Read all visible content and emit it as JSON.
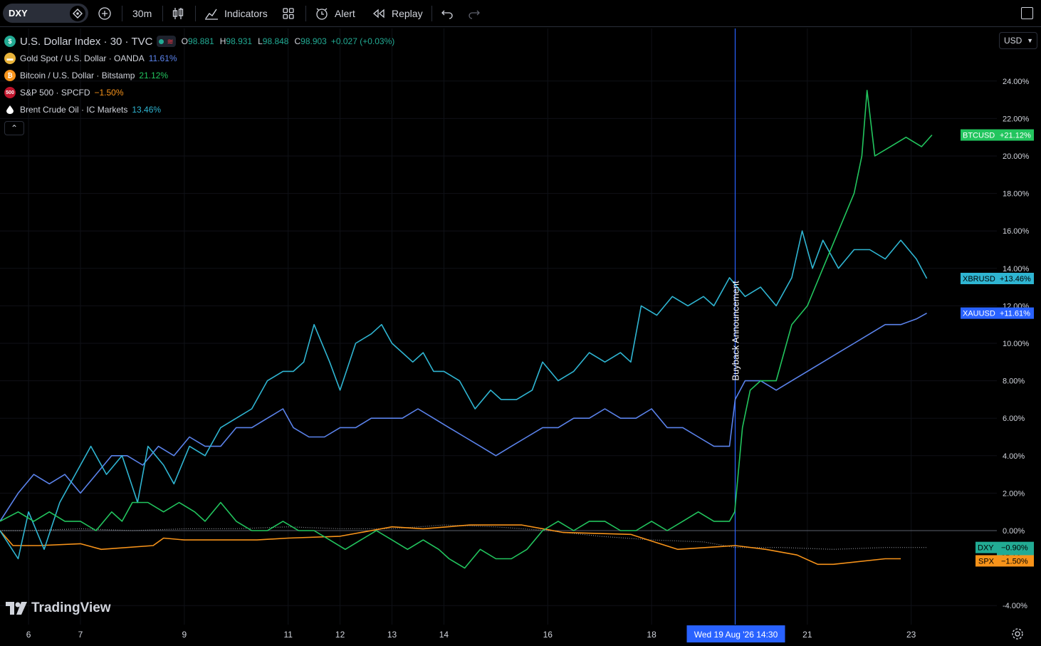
{
  "toolbar": {
    "symbol": "DXY",
    "interval": "30m",
    "indicators_label": "Indicators",
    "alert_label": "Alert",
    "replay_label": "Replay"
  },
  "legend": {
    "main": {
      "title": "U.S. Dollar Index · 30 · TVC",
      "o_label": "O",
      "o": "98.881",
      "h_label": "H",
      "h": "98.931",
      "l_label": "L",
      "l": "98.848",
      "c_label": "C",
      "c": "98.903",
      "change": "+0.027 (+0.03%)"
    },
    "series": [
      {
        "title": "Gold Spot / U.S. Dollar · OANDA",
        "value": "11.61%",
        "color": "#5b83ec",
        "icon": "gold-icon"
      },
      {
        "title": "Bitcoin / U.S. Dollar · Bitstamp",
        "value": "21.12%",
        "color": "#22c55e",
        "icon": "bitcoin-icon"
      },
      {
        "title": "S&P 500 · SPCFD",
        "value": "−1.50%",
        "color": "#f7931a",
        "icon": "sp500-icon",
        "icon_text": "500"
      },
      {
        "title": "Brent Crude Oil · IC Markets",
        "value": "13.46%",
        "color": "#2fb5d2",
        "icon": "oil-drop-icon"
      }
    ]
  },
  "currency": "USD",
  "brand": "TradingView",
  "annotation": "Buyback Announcement",
  "crosshair_label": "Wed 19 Aug '26   14:30",
  "colors": {
    "btc": "#22c55e",
    "oil": "#2fb5d2",
    "gold": "#5b83ec",
    "spx": "#f7931a",
    "dxy": "#8a8d94",
    "crosshair": "#2962ff",
    "background": "#000000"
  },
  "chart_data": {
    "type": "line",
    "title": "",
    "y_unit": "%",
    "ylim": [
      -5,
      25
    ],
    "y_ticks": [
      "24.00%",
      "22.00%",
      "20.00%",
      "18.00%",
      "16.00%",
      "14.00%",
      "12.00%",
      "10.00%",
      "8.00%",
      "6.00%",
      "4.00%",
      "2.00%",
      "0.00%",
      "-4.00%"
    ],
    "y_tick_values": [
      24,
      22,
      20,
      18,
      16,
      14,
      12,
      10,
      8,
      6,
      4,
      2,
      0,
      -4
    ],
    "x_ticks": [
      "6",
      "7",
      "9",
      "11",
      "12",
      "13",
      "14",
      "16",
      "18",
      "21",
      "23"
    ],
    "x_tick_values": [
      6,
      7,
      9,
      11,
      12,
      13,
      14,
      16,
      18,
      21,
      23
    ],
    "xlim": [
      5.45,
      24.65
    ],
    "crosshair_x": 19.61,
    "series": [
      {
        "name": "XBRUSD",
        "label": "+13.46%",
        "color": "#2fb5d2",
        "points": [
          [
            5.45,
            0
          ],
          [
            5.8,
            -1.5
          ],
          [
            6,
            1
          ],
          [
            6.3,
            -1
          ],
          [
            6.6,
            1.5
          ],
          [
            6.9,
            3
          ],
          [
            7.2,
            4.5
          ],
          [
            7.5,
            3
          ],
          [
            7.8,
            4
          ],
          [
            8.1,
            1.5
          ],
          [
            8.3,
            4.5
          ],
          [
            8.6,
            3.5
          ],
          [
            8.8,
            2.5
          ],
          [
            9.1,
            4.5
          ],
          [
            9.4,
            4
          ],
          [
            9.7,
            5.5
          ],
          [
            10,
            6
          ],
          [
            10.3,
            6.5
          ],
          [
            10.6,
            8
          ],
          [
            10.9,
            8.5
          ],
          [
            11.1,
            8.5
          ],
          [
            11.3,
            9
          ],
          [
            11.5,
            11
          ],
          [
            11.8,
            9
          ],
          [
            12,
            7.5
          ],
          [
            12.3,
            10
          ],
          [
            12.6,
            10.5
          ],
          [
            12.8,
            11
          ],
          [
            13,
            10
          ],
          [
            13.2,
            9.5
          ],
          [
            13.4,
            9
          ],
          [
            13.6,
            9.5
          ],
          [
            13.8,
            8.5
          ],
          [
            14,
            8.5
          ],
          [
            14.3,
            8
          ],
          [
            14.6,
            6.5
          ],
          [
            14.9,
            7.5
          ],
          [
            15.1,
            7
          ],
          [
            15.4,
            7
          ],
          [
            15.7,
            7.5
          ],
          [
            15.9,
            9
          ],
          [
            16.2,
            8
          ],
          [
            16.5,
            8.5
          ],
          [
            16.8,
            9.5
          ],
          [
            17.1,
            9
          ],
          [
            17.4,
            9.5
          ],
          [
            17.6,
            9
          ],
          [
            17.8,
            12
          ],
          [
            18.1,
            11.5
          ],
          [
            18.4,
            12.5
          ],
          [
            18.7,
            12
          ],
          [
            19,
            12.5
          ],
          [
            19.2,
            12
          ],
          [
            19.5,
            13.5
          ],
          [
            19.8,
            12.5
          ],
          [
            20.1,
            13
          ],
          [
            20.4,
            12
          ],
          [
            20.7,
            13.5
          ],
          [
            20.9,
            16
          ],
          [
            21.1,
            14
          ],
          [
            21.3,
            15.5
          ],
          [
            21.6,
            14
          ],
          [
            21.9,
            15
          ],
          [
            22.2,
            15
          ],
          [
            22.5,
            14.5
          ],
          [
            22.8,
            15.5
          ],
          [
            23.1,
            14.5
          ],
          [
            23.3,
            13.46
          ]
        ]
      },
      {
        "name": "BTCUSD",
        "label": "+21.12%",
        "color": "#22c55e",
        "points": [
          [
            5.45,
            0.5
          ],
          [
            5.8,
            1
          ],
          [
            6.1,
            0.5
          ],
          [
            6.4,
            1
          ],
          [
            6.7,
            0.5
          ],
          [
            7,
            0.5
          ],
          [
            7.3,
            0
          ],
          [
            7.6,
            1
          ],
          [
            7.8,
            0.5
          ],
          [
            8,
            1.5
          ],
          [
            8.3,
            1.5
          ],
          [
            8.6,
            1
          ],
          [
            8.9,
            1.5
          ],
          [
            9.2,
            1
          ],
          [
            9.4,
            0.5
          ],
          [
            9.7,
            1.5
          ],
          [
            10,
            0.5
          ],
          [
            10.3,
            0
          ],
          [
            10.6,
            0
          ],
          [
            10.9,
            0.5
          ],
          [
            11.2,
            0
          ],
          [
            11.5,
            0
          ],
          [
            11.8,
            -0.5
          ],
          [
            12.1,
            -1
          ],
          [
            12.4,
            -0.5
          ],
          [
            12.7,
            0
          ],
          [
            13,
            -0.5
          ],
          [
            13.3,
            -1
          ],
          [
            13.6,
            -0.5
          ],
          [
            13.9,
            -1
          ],
          [
            14.1,
            -1.5
          ],
          [
            14.4,
            -2
          ],
          [
            14.7,
            -1
          ],
          [
            15,
            -1.5
          ],
          [
            15.3,
            -1.5
          ],
          [
            15.6,
            -1
          ],
          [
            15.9,
            0
          ],
          [
            16.2,
            0.5
          ],
          [
            16.5,
            0
          ],
          [
            16.8,
            0.5
          ],
          [
            17.1,
            0.5
          ],
          [
            17.4,
            0
          ],
          [
            17.7,
            0
          ],
          [
            18,
            0.5
          ],
          [
            18.3,
            0
          ],
          [
            18.6,
            0.5
          ],
          [
            18.9,
            1
          ],
          [
            19.2,
            0.5
          ],
          [
            19.5,
            0.5
          ],
          [
            19.6,
            1
          ],
          [
            19.75,
            5.5
          ],
          [
            19.9,
            7.5
          ],
          [
            20.1,
            8
          ],
          [
            20.4,
            8
          ],
          [
            20.7,
            11
          ],
          [
            21,
            12
          ],
          [
            21.3,
            14
          ],
          [
            21.6,
            16
          ],
          [
            21.9,
            18
          ],
          [
            22.05,
            20
          ],
          [
            22.15,
            23.5
          ],
          [
            22.3,
            20
          ],
          [
            22.6,
            20.5
          ],
          [
            22.9,
            21
          ],
          [
            23.2,
            20.5
          ],
          [
            23.4,
            21.12
          ]
        ]
      },
      {
        "name": "XAUUSD",
        "label": "+11.61%",
        "color": "#5b83ec",
        "points": [
          [
            5.45,
            0.5
          ],
          [
            5.8,
            2
          ],
          [
            6.1,
            3
          ],
          [
            6.4,
            2.5
          ],
          [
            6.7,
            3
          ],
          [
            7,
            2
          ],
          [
            7.3,
            3
          ],
          [
            7.6,
            4
          ],
          [
            7.9,
            4
          ],
          [
            8.2,
            3.5
          ],
          [
            8.5,
            4.5
          ],
          [
            8.8,
            4
          ],
          [
            9.1,
            5
          ],
          [
            9.4,
            4.5
          ],
          [
            9.7,
            4.5
          ],
          [
            10,
            5.5
          ],
          [
            10.3,
            5.5
          ],
          [
            10.6,
            6
          ],
          [
            10.9,
            6.5
          ],
          [
            11.1,
            5.5
          ],
          [
            11.4,
            5
          ],
          [
            11.7,
            5
          ],
          [
            12,
            5.5
          ],
          [
            12.3,
            5.5
          ],
          [
            12.6,
            6
          ],
          [
            12.9,
            6
          ],
          [
            13.2,
            6
          ],
          [
            13.5,
            6.5
          ],
          [
            13.8,
            6
          ],
          [
            14.1,
            5.5
          ],
          [
            14.4,
            5
          ],
          [
            14.7,
            4.5
          ],
          [
            15,
            4
          ],
          [
            15.3,
            4.5
          ],
          [
            15.6,
            5
          ],
          [
            15.9,
            5.5
          ],
          [
            16.2,
            5.5
          ],
          [
            16.5,
            6
          ],
          [
            16.8,
            6
          ],
          [
            17.1,
            6.5
          ],
          [
            17.4,
            6
          ],
          [
            17.7,
            6
          ],
          [
            18,
            6.5
          ],
          [
            18.3,
            5.5
          ],
          [
            18.6,
            5.5
          ],
          [
            18.9,
            5
          ],
          [
            19.2,
            4.5
          ],
          [
            19.5,
            4.5
          ],
          [
            19.61,
            7
          ],
          [
            19.8,
            8
          ],
          [
            20.1,
            8
          ],
          [
            20.4,
            7.5
          ],
          [
            20.7,
            8
          ],
          [
            21,
            8.5
          ],
          [
            21.3,
            9
          ],
          [
            21.6,
            9.5
          ],
          [
            21.9,
            10
          ],
          [
            22.2,
            10.5
          ],
          [
            22.5,
            11
          ],
          [
            22.8,
            11
          ],
          [
            23.1,
            11.3
          ],
          [
            23.3,
            11.61
          ]
        ]
      },
      {
        "name": "SPX",
        "label": "−1.50%",
        "color": "#f7931a",
        "points": [
          [
            5.45,
            0
          ],
          [
            5.7,
            -0.8
          ],
          [
            6.2,
            -0.8
          ],
          [
            7,
            -0.7
          ],
          [
            7.4,
            -1
          ],
          [
            8.4,
            -0.8
          ],
          [
            8.6,
            -0.4
          ],
          [
            9,
            -0.5
          ],
          [
            10.4,
            -0.5
          ],
          [
            11,
            -0.4
          ],
          [
            12,
            -0.3
          ],
          [
            13,
            0.2
          ],
          [
            13.6,
            0.1
          ],
          [
            14.5,
            0.3
          ],
          [
            15.5,
            0.3
          ],
          [
            16.3,
            -0.1
          ],
          [
            17.6,
            -0.2
          ],
          [
            18.5,
            -1
          ],
          [
            19.61,
            -0.8
          ],
          [
            20.2,
            -1
          ],
          [
            20.8,
            -1.3
          ],
          [
            21.2,
            -1.8
          ],
          [
            21.5,
            -1.8
          ],
          [
            22.5,
            -1.5
          ],
          [
            22.8,
            -1.5
          ]
        ]
      },
      {
        "name": "DXY",
        "label": "−0.90%",
        "color": "#8a8d94",
        "countdown": "05:16",
        "points": [
          [
            5.45,
            0
          ],
          [
            6,
            0
          ],
          [
            7,
            0.1
          ],
          [
            8,
            0
          ],
          [
            9,
            0.1
          ],
          [
            10,
            0.1
          ],
          [
            11,
            0.2
          ],
          [
            12,
            0.1
          ],
          [
            13,
            0.1
          ],
          [
            14,
            0.3
          ],
          [
            15,
            0.2
          ],
          [
            16,
            0
          ],
          [
            17,
            -0.3
          ],
          [
            18,
            -0.5
          ],
          [
            19,
            -0.6
          ],
          [
            19.61,
            -0.9
          ],
          [
            20.5,
            -0.9
          ],
          [
            21.5,
            -1
          ],
          [
            22.5,
            -0.9
          ],
          [
            23.3,
            -0.9
          ]
        ]
      }
    ]
  }
}
